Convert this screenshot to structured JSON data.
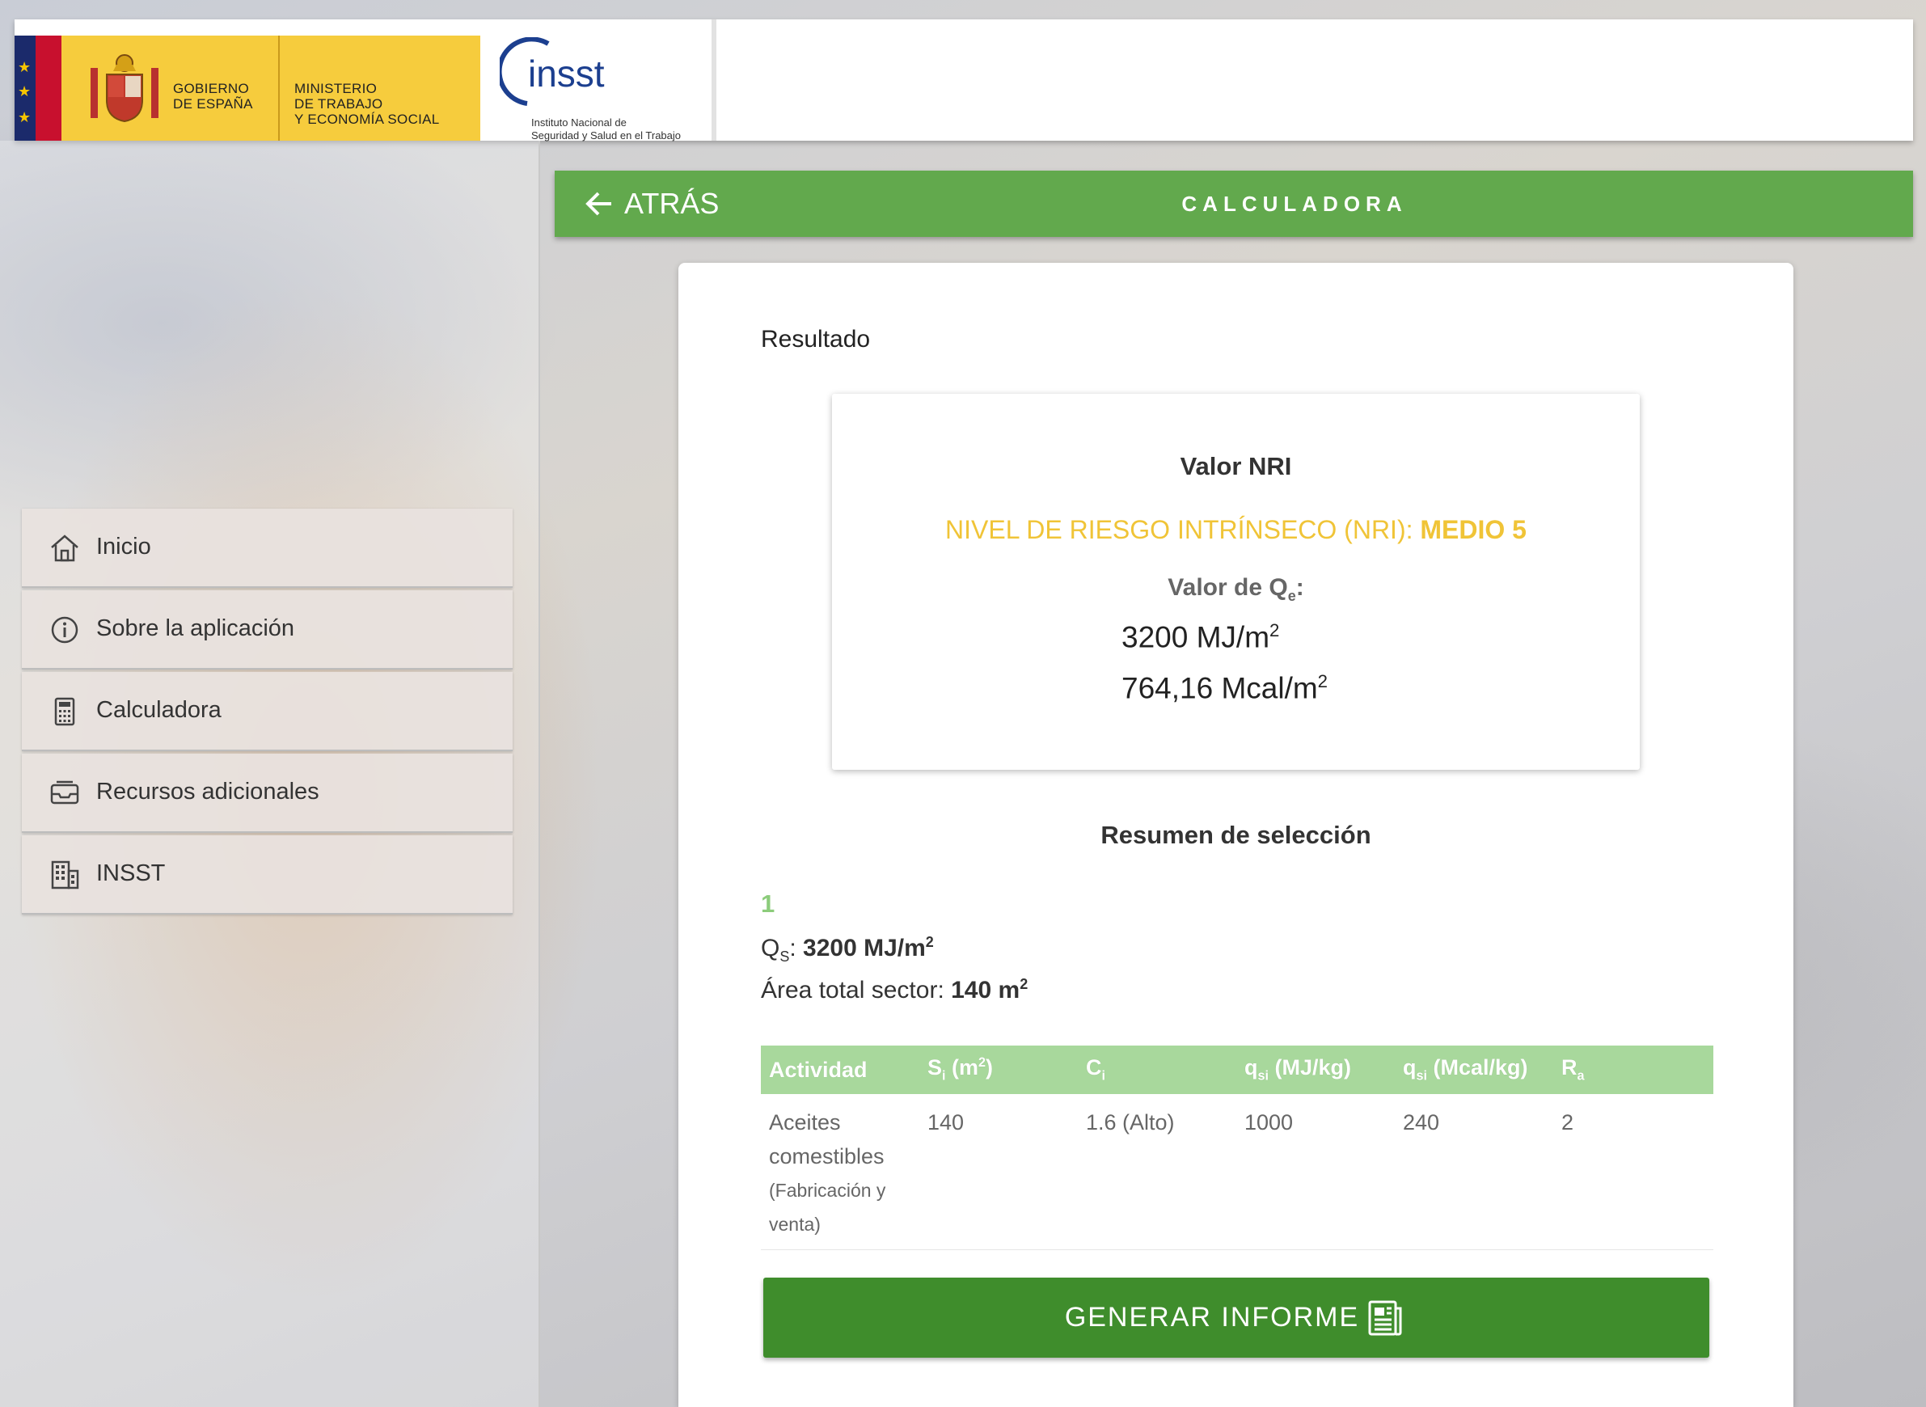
{
  "header": {
    "gov_line1": "GOBIERNO",
    "gov_line2": "DE ESPAÑA",
    "ministry_line1": "MINISTERIO",
    "ministry_line2": "DE TRABAJO",
    "ministry_line3": "Y ECONOMÍA SOCIAL",
    "insst_word": "insst",
    "insst_sub1": "Instituto Nacional de",
    "insst_sub2": "Seguridad y Salud en el Trabajo"
  },
  "topbar": {
    "back_label": "ATRÁS",
    "title": "CALCULADORA"
  },
  "sidebar": {
    "items": [
      {
        "label": "Inicio",
        "icon": "home-icon"
      },
      {
        "label": "Sobre la aplicación",
        "icon": "info-icon"
      },
      {
        "label": "Calculadora",
        "icon": "calculator-icon"
      },
      {
        "label": "Recursos adicionales",
        "icon": "inbox-icon"
      },
      {
        "label": "INSST",
        "icon": "building-icon"
      }
    ]
  },
  "result": {
    "heading": "Resultado",
    "nri_title": "Valor NRI",
    "nri_level_prefix": "NIVEL DE RIESGO INTRÍNSECO (NRI): ",
    "nri_level_value": "MEDIO 5",
    "qe_label_prefix": "Valor de Q",
    "qe_label_sub": "e",
    "qe_label_suffix": ":",
    "qe_mj": "3200 MJ/m",
    "qe_mcal": "764,16 Mcal/m",
    "sq": "2"
  },
  "summary": {
    "title": "Resumen de selección",
    "number": "1",
    "qs_label": "Q",
    "qs_sub": "S",
    "qs_colon": ": ",
    "qs_value": "3200 MJ/m",
    "area_label": "Área total sector: ",
    "area_value": "140 m",
    "sq": "2",
    "table": {
      "headers": {
        "actividad": "Actividad",
        "si": "S",
        "si_sub": "i",
        "si_unit": " (m",
        "si_unit_end": ")",
        "ci": "C",
        "ci_sub": "i",
        "qsi_mj": "q",
        "qsi_mj_sub": "si",
        "qsi_mj_unit": " (MJ/kg)",
        "qsi_mcal": "q",
        "qsi_mcal_sub": "si",
        "qsi_mcal_unit": " (Mcal/kg)",
        "ra": "R",
        "ra_sub": "a"
      },
      "row": {
        "actividad": "Aceites comestibles",
        "actividad_note": "(Fabricación y venta)",
        "si": "140",
        "ci": "1.6 (Alto)",
        "qsi_mj": "1000",
        "qsi_mcal": "240",
        "ra": "2"
      }
    }
  },
  "actions": {
    "generate_label": "GENERAR INFORME"
  },
  "colors": {
    "accent_green": "#62a94d",
    "button_green": "#3f8d2c",
    "table_header_green": "#a8d89c",
    "nri_yellow": "#f0c437",
    "gov_yellow": "#f6cc3d"
  }
}
